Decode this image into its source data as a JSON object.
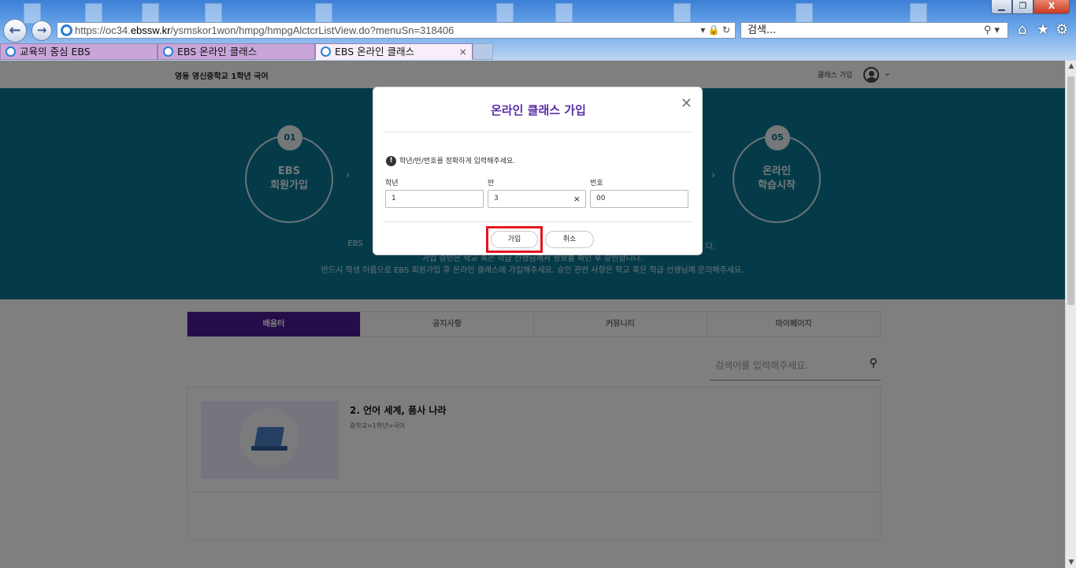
{
  "browser": {
    "url_prefix": "https://oc34.",
    "url_domain": "ebssw.kr",
    "url_path": "/ysmskor1won/hmpg/hmpgAlctcrListView.do?menuSn=318406",
    "search_placeholder": "검색...",
    "tabs": [
      {
        "label": "교육의 중심 EBS"
      },
      {
        "label": "EBS 온라인 클래스"
      },
      {
        "label": "EBS 온라인 클래스",
        "close": "×"
      }
    ],
    "window_buttons": {
      "minimize": "▁",
      "restore": "❐",
      "close": "X"
    },
    "back": "←",
    "forward": "→",
    "lock_refresh": "▾ 🔒 ↻",
    "search_icon": "⚲ ▾",
    "home_icon": "⌂",
    "favorites_icon": "★",
    "tools_icon": "⚙"
  },
  "header": {
    "school": "영동 영신중학교 1학년 국어",
    "join_link": "클래스 가입",
    "chevron": "⌄"
  },
  "hero": {
    "steps": [
      {
        "num": "01",
        "label": "EBS\n회원가입"
      },
      {
        "num": "05",
        "label": "온라인\n학습시작"
      }
    ],
    "arrow": "›",
    "note_left": "EBS",
    "note_right": "다.",
    "note2": "가입 승인은 학교 혹은 학급 선생님께서 정보를 확인 후 승인합니다.",
    "note3": "반드시 학생 이름으로 EBS 회원가입 후 온라인 클래스에 가입해주세요. 승인 관련 사항은 학교 혹은 학급 선생님께 문의해주세요."
  },
  "menu": {
    "items": [
      "배움터",
      "공지사항",
      "커뮤니티",
      "마이페이지"
    ]
  },
  "search": {
    "placeholder": "검색어를 입력해주세요.",
    "icon": "⚲"
  },
  "course": {
    "title": "2. 언어 세계, 품사 나라",
    "path": "중학교>1학년>국어"
  },
  "modal": {
    "title": "온라인 클래스 가입",
    "close": "✕",
    "notice_icon": "!",
    "notice": "학년/반/번호를 정확하게 입력해주세요.",
    "fields": [
      {
        "label": "학년",
        "value": "1"
      },
      {
        "label": "반",
        "value": "3",
        "clear": "×"
      },
      {
        "label": "번호",
        "value": "00"
      }
    ],
    "join_label": "가입",
    "cancel_label": "취소"
  },
  "colors": {
    "accent": "#4b1a93",
    "title": "#5a2ea6",
    "hero": "#0a7693",
    "highlight": "#e4141f"
  }
}
